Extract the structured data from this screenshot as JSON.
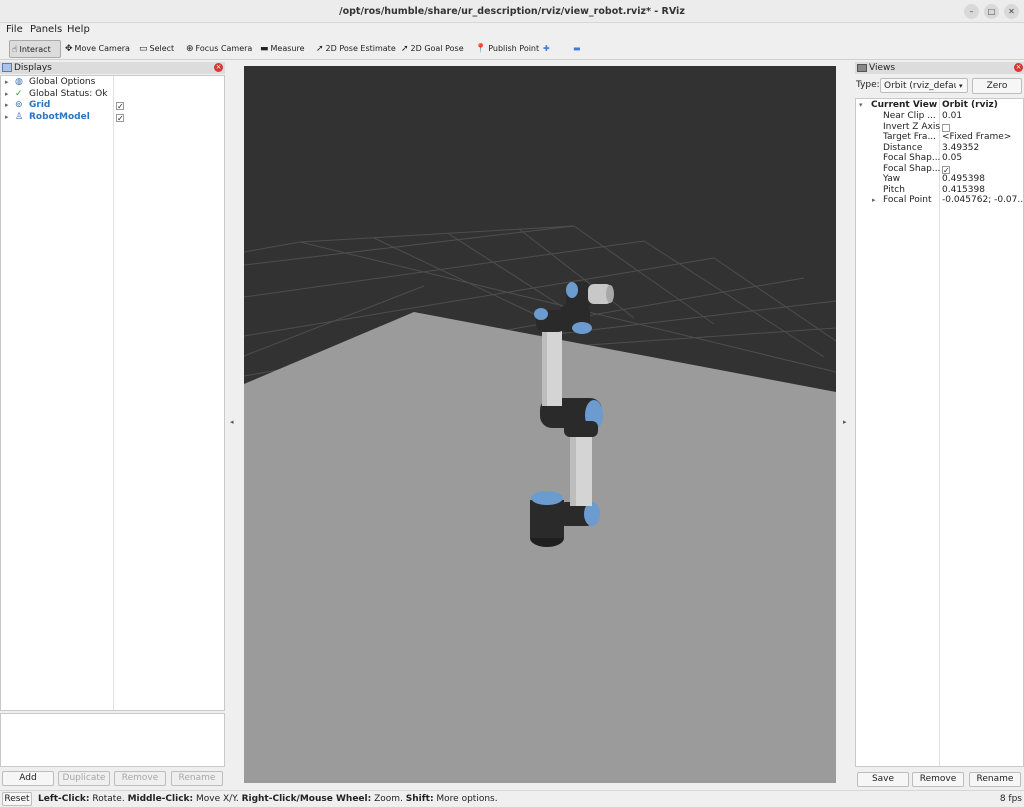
{
  "window": {
    "title": "/opt/ros/humble/share/ur_description/rviz/view_robot.rviz* - RViz",
    "controls": [
      "–",
      "□",
      "✕"
    ]
  },
  "menu": [
    "File",
    "Panels",
    "Help"
  ],
  "toolbar": {
    "tools": [
      {
        "label": "Interact",
        "icon": "hand-pointer-icon",
        "glyph": "☝",
        "active": true
      },
      {
        "label": "Move Camera",
        "icon": "move-camera-icon",
        "glyph": "✥",
        "active": false
      },
      {
        "label": "Select",
        "icon": "select-icon",
        "glyph": "▭",
        "active": false
      },
      {
        "label": "Focus Camera",
        "icon": "focus-camera-icon",
        "glyph": "⊕",
        "active": false
      },
      {
        "label": "Measure",
        "icon": "ruler-icon",
        "glyph": "▬",
        "active": false
      },
      {
        "label": "2D Pose Estimate",
        "icon": "pose-estimate-arrow-icon",
        "glyph": "➚",
        "active": false
      },
      {
        "label": "2D Goal Pose",
        "icon": "goal-pose-arrow-icon",
        "glyph": "➚",
        "active": false
      },
      {
        "label": "Publish Point",
        "icon": "map-pin-icon",
        "glyph": "📍",
        "active": false
      }
    ],
    "add_tool_glyph": "✚",
    "remove_tool_glyph": "▬"
  },
  "displays": {
    "title": "Displays",
    "items": [
      {
        "label": "Global Options",
        "icon": "globe-icon",
        "glyph": "◍",
        "blue": false,
        "checked": null
      },
      {
        "label": "Global Status: Ok",
        "icon": "checkmark-icon",
        "glyph": "✓",
        "blue": false,
        "checked": null
      },
      {
        "label": "Grid",
        "icon": "grid-icon",
        "glyph": "⊚",
        "blue": true,
        "checked": true
      },
      {
        "label": "RobotModel",
        "icon": "robot-icon",
        "glyph": "♙",
        "blue": true,
        "checked": true
      }
    ],
    "buttons": [
      {
        "label": "Add",
        "disabled": false
      },
      {
        "label": "Duplicate",
        "disabled": true
      },
      {
        "label": "Remove",
        "disabled": true
      },
      {
        "label": "Rename",
        "disabled": true
      }
    ]
  },
  "views": {
    "title": "Views",
    "type_label": "Type:",
    "type_value": "Orbit (rviz_default_plugins)",
    "zero_label": "Zero",
    "current_view": {
      "name": "Current View",
      "value": "Orbit (rviz)"
    },
    "properties": [
      {
        "name": "Near Clip ...",
        "value": "0.01",
        "kind": "text"
      },
      {
        "name": "Invert Z Axis",
        "value": "",
        "kind": "checkbox",
        "checked": false
      },
      {
        "name": "Target Fra...",
        "value": "<Fixed Frame>",
        "kind": "text"
      },
      {
        "name": "Distance",
        "value": "3.49352",
        "kind": "text"
      },
      {
        "name": "Focal Shap...",
        "value": "0.05",
        "kind": "text"
      },
      {
        "name": "Focal Shap...",
        "value": "",
        "kind": "checkbox",
        "checked": true
      },
      {
        "name": "Yaw",
        "value": "0.495398",
        "kind": "text"
      },
      {
        "name": "Pitch",
        "value": "0.415398",
        "kind": "text"
      },
      {
        "name": "Focal Point",
        "value": "-0.045762; -0.07...",
        "kind": "text",
        "expandable": true
      }
    ],
    "buttons": [
      "Save",
      "Remove",
      "Rename"
    ]
  },
  "statusbar": {
    "reset": "Reset",
    "hints": [
      {
        "key": "Left-Click:",
        "desc": " Rotate. "
      },
      {
        "key": "Middle-Click:",
        "desc": " Move X/Y. "
      },
      {
        "key": "Right-Click/Mouse Wheel:",
        "desc": " Zoom. "
      },
      {
        "key": "Shift:",
        "desc": " More options."
      }
    ],
    "fps": "8 fps"
  },
  "colors": {
    "viewport_bg": "#323232",
    "ground": "#9b9b9b",
    "grid_line": "#4c4c4c",
    "robot_dark": "#2a2a2a",
    "robot_link": "#d4d4d4",
    "robot_accent": "#6c9bd0",
    "link_blue": "#2a76c6"
  }
}
